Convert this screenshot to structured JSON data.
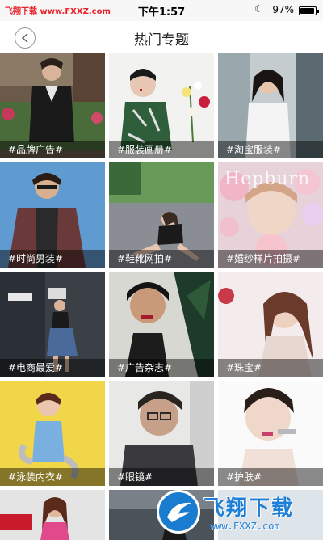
{
  "status_bar": {
    "carrier": "飞翔下载 www.FXXZ.com",
    "time": "下午1:57",
    "moon": "☾",
    "battery_percent": "97%",
    "battery_level": 0.97
  },
  "nav": {
    "title": "热门专题"
  },
  "tiles": [
    {
      "label": "#品牌广告#"
    },
    {
      "label": "#服装画册#"
    },
    {
      "label": "#淘宝服装#"
    },
    {
      "label": "#时尚男装#"
    },
    {
      "label": "#鞋靴网拍#"
    },
    {
      "label": "#婚纱样片拍摄#"
    },
    {
      "label": "#电商最爱#"
    },
    {
      "label": "#广告杂志#"
    },
    {
      "label": "#珠宝#"
    },
    {
      "label": "#泳装内衣#"
    },
    {
      "label": "#眼镜#"
    },
    {
      "label": "#护肤#"
    }
  ],
  "photo_text": {
    "hepburn": "Hepburn"
  },
  "watermark": {
    "title": "飞翔下载",
    "url": "www.FXXZ.com"
  },
  "colors": {
    "carrier_red": "#e8222a",
    "watermark_blue": "#1f7fd6",
    "label_overlay": "rgba(0,0,0,0.45)"
  }
}
